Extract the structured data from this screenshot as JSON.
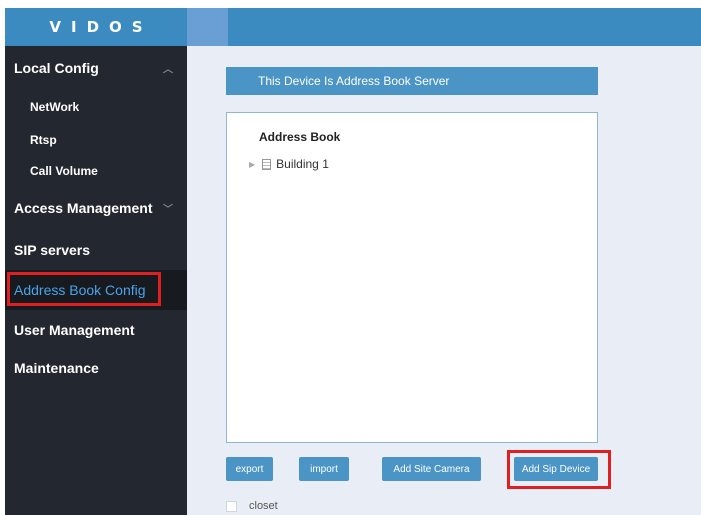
{
  "header": {
    "logo": "VIDOS"
  },
  "sidebar": {
    "items": [
      {
        "label": "Local Config",
        "chevron": "︿"
      },
      {
        "label": "NetWork"
      },
      {
        "label": "Rtsp"
      },
      {
        "label": "Call Volume"
      },
      {
        "label": "Access Management",
        "chevron": "﹀"
      },
      {
        "label": "SIP servers"
      },
      {
        "label": "Address Book Config",
        "active": true
      },
      {
        "label": "User Management"
      },
      {
        "label": "Maintenance"
      }
    ]
  },
  "main": {
    "banner": "This Device Is Address Book Server",
    "panel_title": "Address Book",
    "tree": [
      {
        "label": "Building 1",
        "icon": "building-icon"
      }
    ],
    "buttons": {
      "export": "export",
      "import": "import",
      "add_site_camera": "Add Site Camera",
      "add_sip_device": "Add Sip Device"
    },
    "closet_label": "closet"
  },
  "colors": {
    "header_blue": "#3b8bc0",
    "sidebar_bg": "#23272f",
    "active_text": "#4aa3ea",
    "highlight_red": "#e02020",
    "button_blue": "#4a94c6"
  }
}
